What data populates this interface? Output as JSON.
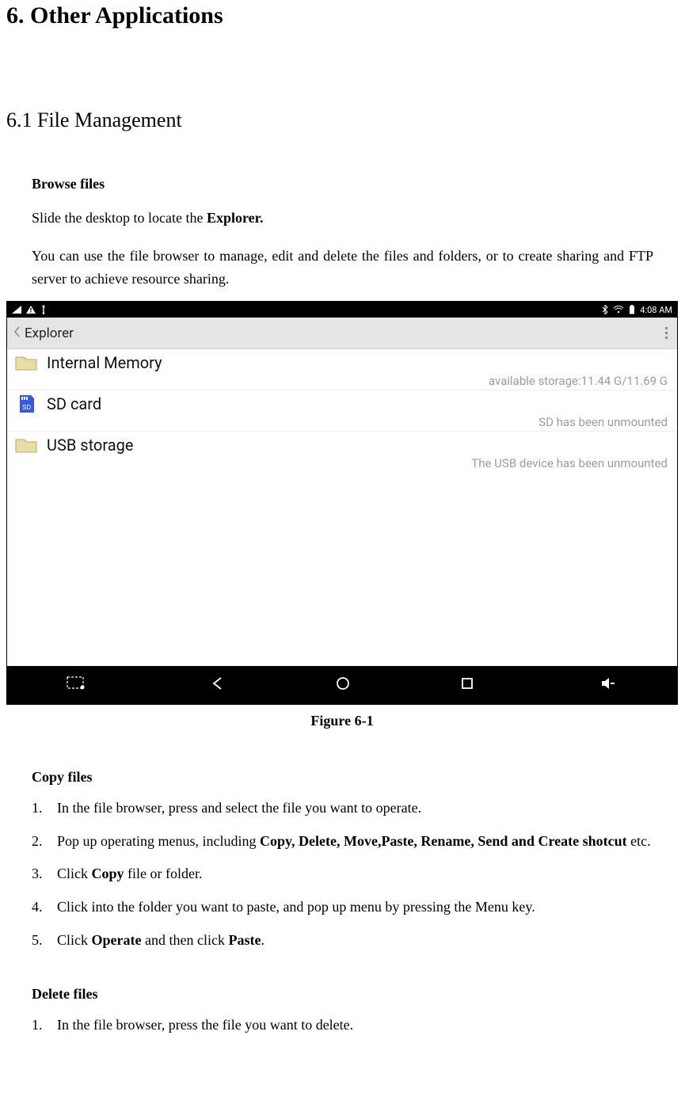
{
  "heading1": "6. Other Applications",
  "heading2": "6.1 File Management",
  "browse_files": {
    "title": "Browse files",
    "p1_pre": "Slide the desktop to locate the ",
    "p1_bold": "Explorer.",
    "p2": "You can use the file browser to manage, edit and delete the files and folders, or to create sharing and FTP server to achieve resource sharing."
  },
  "screenshot": {
    "status_time": "4:08 AM",
    "app_title": "Explorer",
    "items": [
      {
        "name": "Internal Memory",
        "sub": "available storage:11.44 G/11.69 G"
      },
      {
        "name": "SD card",
        "sub": "SD has been unmounted"
      },
      {
        "name": "USB storage",
        "sub": "The USB device has been unmounted"
      }
    ]
  },
  "figure_caption": "Figure 6-1",
  "copy_files": {
    "title": "Copy files",
    "items": [
      {
        "num": "1.",
        "text": "In the file browser, press and select the file you want to operate."
      },
      {
        "num": "2.",
        "pre": "Pop up operating menus, including ",
        "bold": "Copy, Delete, Move,Paste, Rename, Send and Create shotcut",
        "post": " etc."
      },
      {
        "num": "3.",
        "pre": "Click ",
        "bold": "Copy",
        "post": " file or folder."
      },
      {
        "num": "4.",
        "text": "Click into the folder you want to paste, and pop up menu by pressing the Menu key."
      },
      {
        "num": "5.",
        "pre": "Click ",
        "bold1": "Operate",
        "mid": " and then click ",
        "bold2": "Paste",
        "post": "."
      }
    ]
  },
  "delete_files": {
    "title": "Delete files",
    "items": [
      {
        "num": "1.",
        "text": "In the file browser, press the file you want to delete."
      }
    ]
  }
}
